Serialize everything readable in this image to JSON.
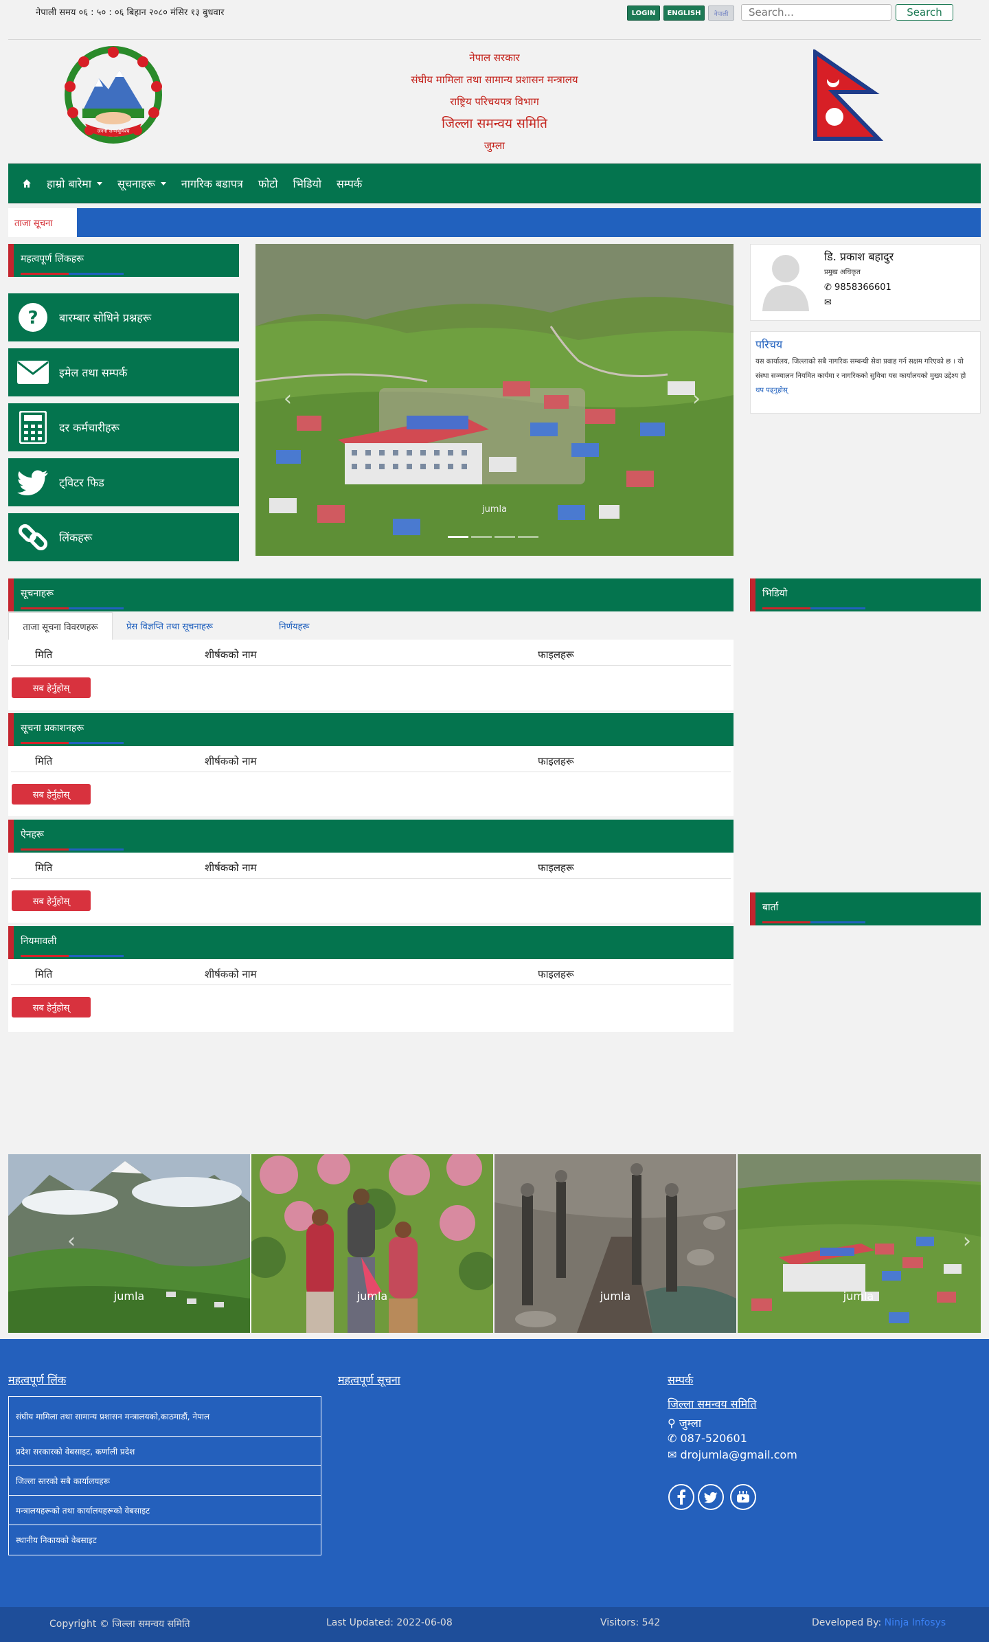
{
  "topbar": {
    "clock": "नेपाली समय ०६ : ५० : ०६ बिहान   २०८० मंसिर १३ बुधवार",
    "login_label": "LOGIN",
    "english_label": "ENGLISH",
    "nepali_label": "नेपाली",
    "search_placeholder": "Search...",
    "search_button": "Search"
  },
  "header": {
    "line1": "नेपाल सरकार",
    "line2": "संघीय मामिला तथा सामान्य प्रशासन मन्त्रालय",
    "line3": "राष्ट्रिय परिचयपत्र विभाग",
    "line4": "जिल्ला समन्वय समिति",
    "line5": "जुम्ला"
  },
  "nav": {
    "items": [
      {
        "label": "हाम्रो बारेमा",
        "has_caret": true
      },
      {
        "label": "सूचनाहरू",
        "has_caret": true
      },
      {
        "label": "नागरिक बडापत्र",
        "has_caret": false
      },
      {
        "label": "फोटो",
        "has_caret": false
      },
      {
        "label": "भिडियो",
        "has_caret": false
      },
      {
        "label": "सम्पर्क",
        "has_caret": false
      }
    ]
  },
  "ticker": {
    "label": "ताजा सूचना"
  },
  "quick_links": {
    "title": "महत्वपूर्ण लिंकहरू",
    "items": [
      {
        "label": "बारम्बार सोधिने प्रश्नहरू",
        "icon": "question-icon"
      },
      {
        "label": "इमेल तथा सम्पर्क",
        "icon": "envelope-icon"
      },
      {
        "label": "दर कर्मचारीहरू",
        "icon": "calculator-icon"
      },
      {
        "label": "ट्विटर फिड",
        "icon": "twitter-icon"
      },
      {
        "label": "लिंकहरू",
        "icon": "link-icon"
      }
    ]
  },
  "slider": {
    "caption": "jumla"
  },
  "profile": {
    "name": "डि. प्रकाश बहादुर",
    "role": "प्रमुख अधिकृत",
    "phone": "9858366601",
    "email": ""
  },
  "intro": {
    "title": "परिचय",
    "body": "यस कार्यालय, जिल्लाको सबै नागरिक सम्बन्धी सेवा प्रवाह गर्न सक्षम गरिएको छ । यो संस्था सञ्चालन नियमित कार्यमा र नागरिकको सुविधा   यस कार्यालयको मुख्य उद्देश्य हो",
    "more": "थप पढ्नुहोस्"
  },
  "notices": {
    "title": "सूचनाहरू",
    "tabs": [
      "ताजा सूचना विवरणहरू",
      "प्रेस विज्ञप्ति तथा सूचनाहरू",
      "निर्णयहरू"
    ]
  },
  "table": {
    "cols": [
      "मिति",
      "शीर्षकको नाम",
      "फाइलहरू"
    ],
    "view_all": "सब हेर्नुहोस्"
  },
  "sections": [
    {
      "title": "सूचना प्रकाशनहरू"
    },
    {
      "title": "ऐनहरू"
    },
    {
      "title": "नियमावली"
    }
  ],
  "right_sections": [
    {
      "title": "भिडियो"
    },
    {
      "title": "बार्ता"
    }
  ],
  "gallery": [
    {
      "caption": "jumla"
    },
    {
      "caption": "jumla"
    },
    {
      "caption": "jumla"
    },
    {
      "caption": "jumla"
    }
  ],
  "footer": {
    "links_title": "महत्वपूर्ण लिंक",
    "links": [
      "संघीय मामिला तथा सामान्य प्रशासन मन्त्रालयको,काठमाडौं, नेपाल",
      "प्रदेश सरकारको वेबसाइट, कर्णाली प्रदेश",
      "जिल्ला स्तरको सबै कार्यालयहरू",
      "मन्त्रालयहरूको तथा कार्यालयहरूको वेबसाइट",
      "स्थानीय निकायको वेबसाइट"
    ],
    "quick_title": "महत्वपूर्ण सूचना",
    "contact_title": "सम्पर्क",
    "org": "जिल्ला समन्वय समिति",
    "address": "जुम्ला",
    "phone": "087-520601",
    "email": "drojumla@gmail.com"
  },
  "bottombar": {
    "copyright": "Copyright © जिल्ला समन्वय समिति",
    "updated": "Last Updated: 2022-06-08",
    "visitors": "Visitors: 542",
    "developed_prefix": "Developed By:",
    "developer": "Ninja Infosys"
  },
  "colors": {
    "primary_green": "#04744e",
    "accent_red": "#c3252e",
    "accent_blue": "#2161be",
    "footer_blue": "#2460bc"
  }
}
